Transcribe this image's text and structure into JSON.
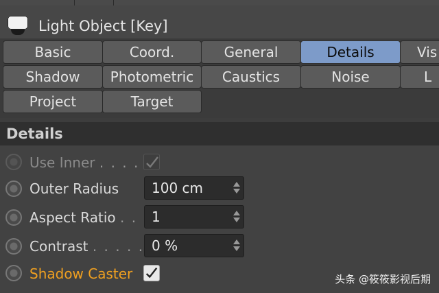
{
  "window": {
    "title": "Light Object [Key]"
  },
  "tabs": [
    {
      "label": "Basic",
      "active": false
    },
    {
      "label": "Coord.",
      "active": false
    },
    {
      "label": "General",
      "active": false
    },
    {
      "label": "Details",
      "active": true
    },
    {
      "label": "Vis",
      "active": false
    },
    {
      "label": "Shadow",
      "active": false
    },
    {
      "label": "Photometric",
      "active": false
    },
    {
      "label": "Caustics",
      "active": false
    },
    {
      "label": "Noise",
      "active": false
    },
    {
      "label": "L",
      "active": false
    },
    {
      "label": "Project",
      "active": false
    },
    {
      "label": "Target",
      "active": false
    }
  ],
  "section": {
    "title": "Details"
  },
  "params": {
    "use_inner": {
      "label": "Use Inner",
      "dots": ". . . . .",
      "checked": true,
      "enabled": false
    },
    "outer_radius": {
      "label": "Outer Radius",
      "value": "100 cm"
    },
    "aspect_ratio": {
      "label": "Aspect Ratio",
      "dots": ". .",
      "value": "1"
    },
    "contrast": {
      "label": "Contrast",
      "dots": ". . . . .",
      "value": "0 %"
    },
    "shadow_caster": {
      "label": "Shadow Caster",
      "checked": true,
      "highlight_color": "#f0a020"
    }
  },
  "watermark": {
    "text": "头条 @筱筱影视后期"
  },
  "colors": {
    "active_tab": "#7d9bc9",
    "panel_bg": "#3d3d3d",
    "orange_label": "#f0a020"
  }
}
